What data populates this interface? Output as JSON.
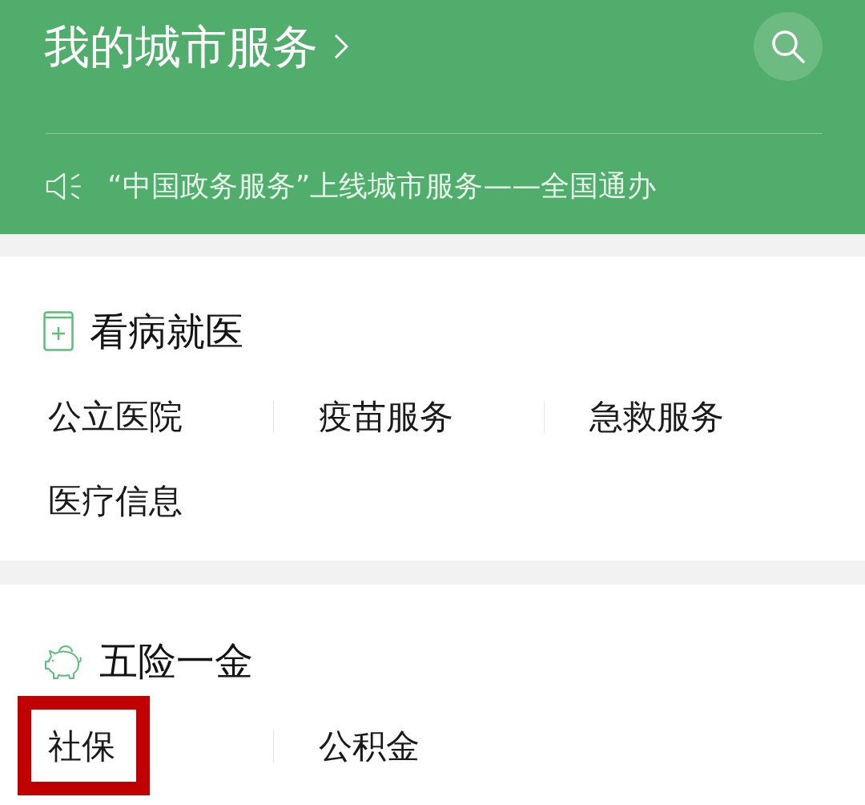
{
  "header": {
    "title": "我的城市服务",
    "notice": "“中国政务服务”上线城市服务——全国通办"
  },
  "sections": [
    {
      "kind": "medical",
      "title": "看病就医",
      "items": [
        {
          "label": "公立医院",
          "highlighted": false
        },
        {
          "label": "疫苗服务",
          "highlighted": false
        },
        {
          "label": "急救服务",
          "highlighted": false
        },
        {
          "label": "医疗信息",
          "highlighted": false
        }
      ]
    },
    {
      "kind": "savings",
      "title": "五险一金",
      "items": [
        {
          "label": "社保",
          "highlighted": true
        },
        {
          "label": "公积金",
          "highlighted": false
        }
      ]
    }
  ]
}
